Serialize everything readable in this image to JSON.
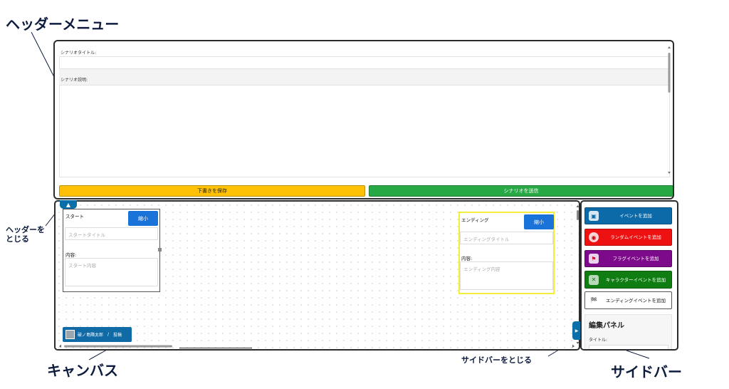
{
  "annotations": {
    "header_menu": "ヘッダーメニュー",
    "close_header": "ヘッダーを\nとじる",
    "canvas": "キャンバス",
    "close_sidebar": "サイドバーをとじる",
    "sidebar": "サイドバー"
  },
  "header": {
    "title_label": "シナリオタイトル:",
    "desc_label": "シナリオ説明:",
    "save_label": "下書きを保存",
    "send_label": "シナリオを送信"
  },
  "toggle_header_symbol": "▲",
  "canvas": {
    "start": {
      "heading": "スタート",
      "shrink": "縮小",
      "title_placeholder": "スタートタイトル",
      "content_label": "内容:",
      "content_placeholder": "スタート内容"
    },
    "ending": {
      "heading": "エンディング",
      "shrink": "縮小",
      "title_placeholder": "エンディングタイトル",
      "content_label": "内容:",
      "content_placeholder": "エンディング内容"
    },
    "user": {
      "name": "破ノ島隣太郎",
      "separator": "/",
      "action": "投稿"
    }
  },
  "toggle_sidebar_symbol": "▶",
  "sidebar": {
    "buttons": [
      {
        "label": "イベントを追加",
        "bg": "#0d6aa8",
        "fg": "#ffffff",
        "icon": "event-icon"
      },
      {
        "label": "ランダムイベントを追加",
        "bg": "#ee1111",
        "fg": "#ffffff",
        "icon": "random-icon"
      },
      {
        "label": "フラグイベントを追加",
        "bg": "#7d0a8a",
        "fg": "#ffffff",
        "icon": "flag-icon"
      },
      {
        "label": "キャラクターイベントを追加",
        "bg": "#0f7d12",
        "fg": "#ffffff",
        "icon": "character-icon"
      },
      {
        "label": "エンディングイベントを追加",
        "bg": "#ffffff",
        "fg": "#111111",
        "icon": "checkered-flag-icon"
      }
    ],
    "edit_panel": {
      "title": "編集パネル",
      "title_label": "タイトル:"
    }
  }
}
